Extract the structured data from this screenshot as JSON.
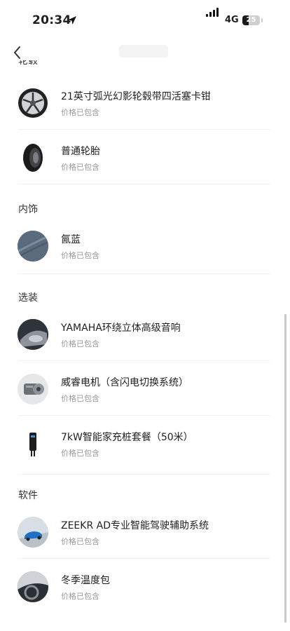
{
  "status_bar": {
    "time": "20:34",
    "network": "4G",
    "battery": "25"
  },
  "sections": [
    {
      "title": "轮毂",
      "items": [
        {
          "name": "21英寸弧光幻影轮毂带四活塞卡钳",
          "price": "价格已包含",
          "icon": "wheel-icon"
        },
        {
          "name": "普通轮胎",
          "price": "价格已包含",
          "icon": "tire-icon"
        }
      ]
    },
    {
      "title": "内饰",
      "items": [
        {
          "name": "氤蓝",
          "price": "价格已包含",
          "icon": "interior-swatch-icon"
        }
      ]
    },
    {
      "title": "选装",
      "items": [
        {
          "name": "YAMAHA环绕立体高级音响",
          "price": "价格已包含",
          "icon": "speaker-icon"
        },
        {
          "name": "威睿电机（含闪电切换系统）",
          "price": "价格已包含",
          "icon": "motor-icon"
        },
        {
          "name": "7kW智能家充桩套餐（50米）",
          "price": "价格已包含",
          "icon": "charger-icon"
        }
      ]
    },
    {
      "title": "软件",
      "items": [
        {
          "name": "ZEEKR AD专业智能驾驶辅助系统",
          "price": "价格已包含",
          "icon": "car-icon"
        },
        {
          "name": "冬季温度包",
          "price": "价格已包含",
          "icon": "steering-wheel-icon"
        }
      ]
    }
  ]
}
